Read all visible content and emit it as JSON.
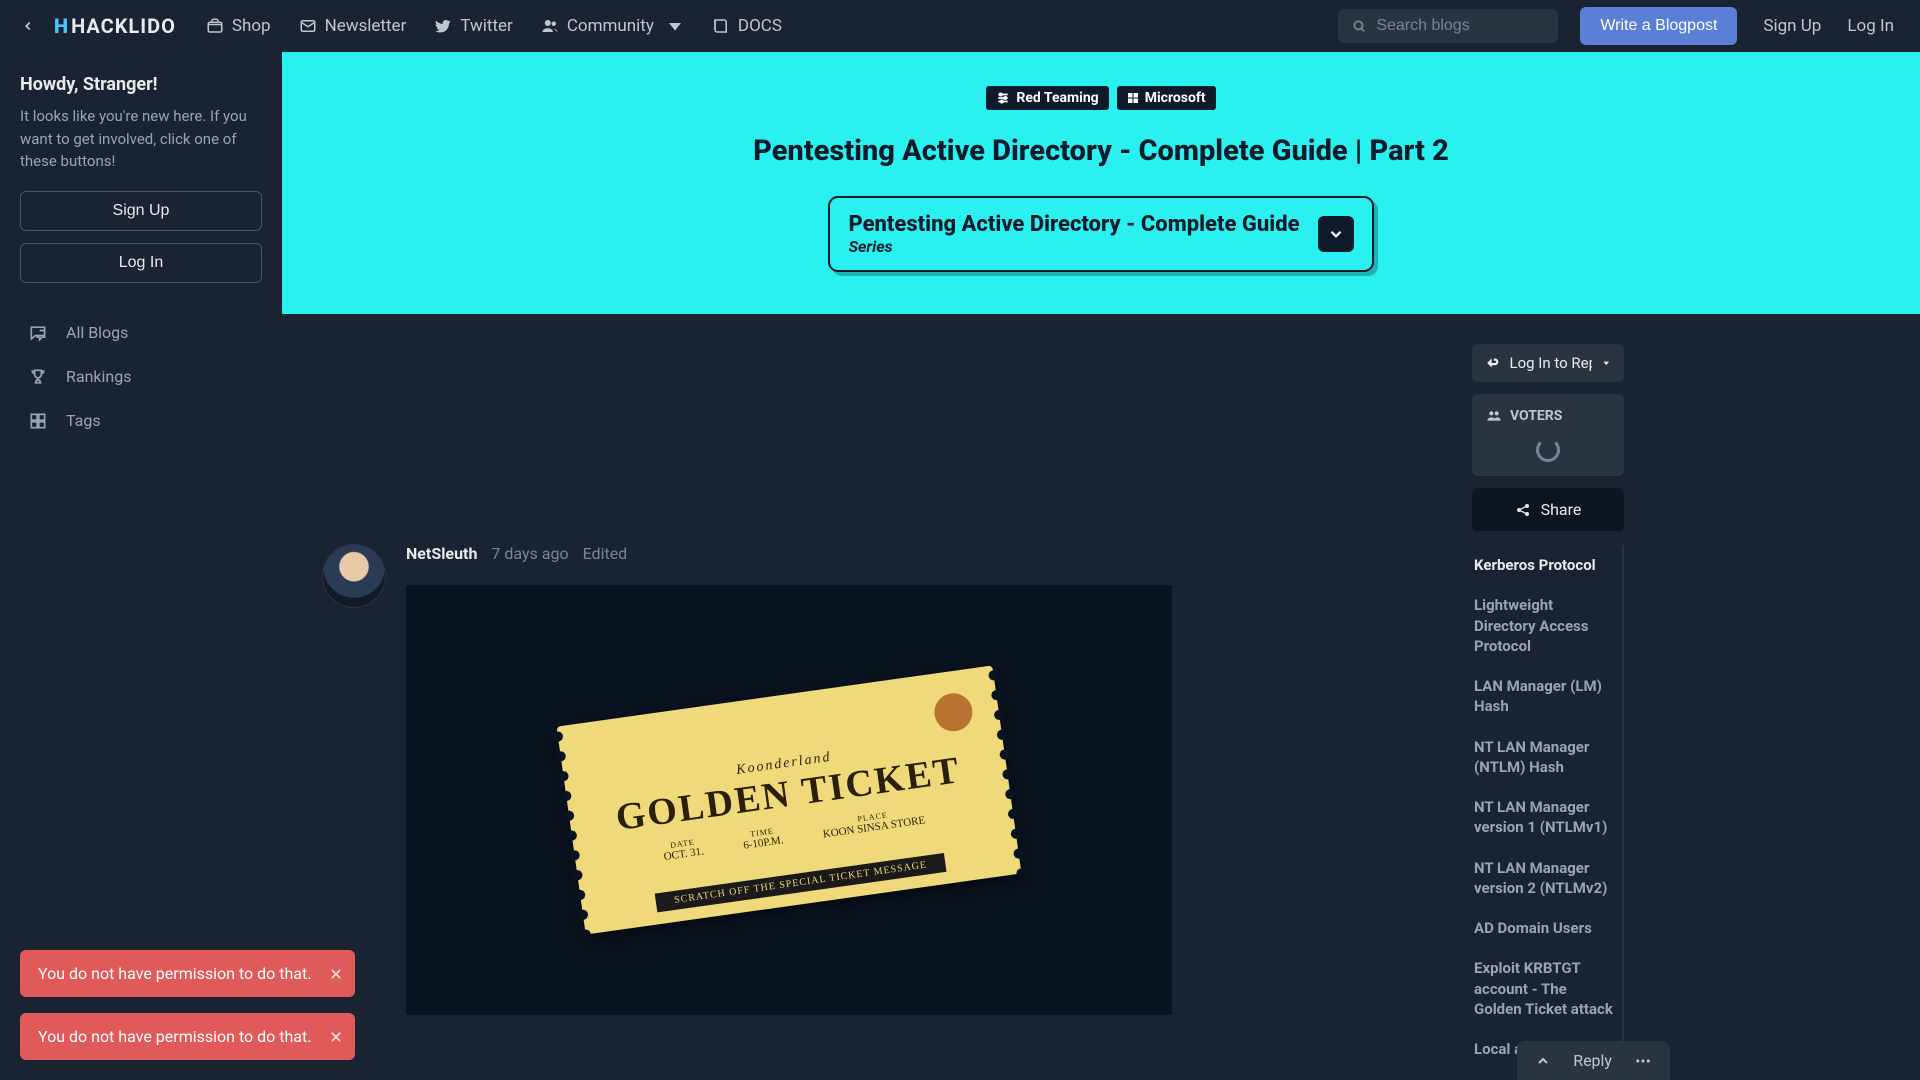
{
  "nav": {
    "logo": "HACKLIDO",
    "links": {
      "shop": "Shop",
      "newsletter": "Newsletter",
      "twitter": "Twitter",
      "community": "Community",
      "docs": "DOCS"
    },
    "search_placeholder": "Search blogs",
    "write": "Write a Blogpost",
    "signup": "Sign Up",
    "login": "Log In"
  },
  "sidebar": {
    "greeting": "Howdy, Stranger!",
    "intro": "It looks like you're new here. If you want to get involved, click one of these buttons!",
    "signup": "Sign Up",
    "login": "Log In",
    "items": [
      {
        "label": "All Blogs"
      },
      {
        "label": "Rankings"
      },
      {
        "label": "Tags"
      }
    ]
  },
  "hero": {
    "tags": [
      {
        "label": "Red Teaming"
      },
      {
        "label": "Microsoft"
      }
    ],
    "title": "Pentesting Active Directory - Complete Guide | Part 2",
    "series_title": "Pentesting Active Directory - Complete Guide",
    "series_sub": "Series"
  },
  "post": {
    "author": "NetSleuth",
    "time": "7 days ago",
    "edited": "Edited",
    "ticket": {
      "brand": "Koonderland",
      "headline": "GOLDEN TICKET",
      "date_label": "DATE",
      "date": "OCT. 31.",
      "time_label": "TIME",
      "time": "6-10P.M.",
      "place_label": "PLACE",
      "place": "KOON SINSA STORE",
      "scratch": "SCRATCH OFF THE SPECIAL TICKET MESSAGE"
    }
  },
  "right": {
    "login_reply": "Log In to Reply",
    "voters": "VOTERS",
    "share": "Share",
    "toc": [
      "Kerberos Protocol",
      "Lightweight Directory Access Protocol",
      "LAN Manager (LM) Hash",
      "NT LAN Manager (NTLM) Hash",
      "NT LAN Manager version 1 (NTLMv1)",
      "NT LAN Manager version 2 (NTLMv2)",
      "AD Domain Users",
      "Exploit KRBTGT account - The Golden Ticket attack",
      "Local accounts"
    ]
  },
  "reply_bar": {
    "reply": "Reply"
  },
  "alerts": [
    "You do not have permission to do that.",
    "You do not have permission to do that."
  ]
}
